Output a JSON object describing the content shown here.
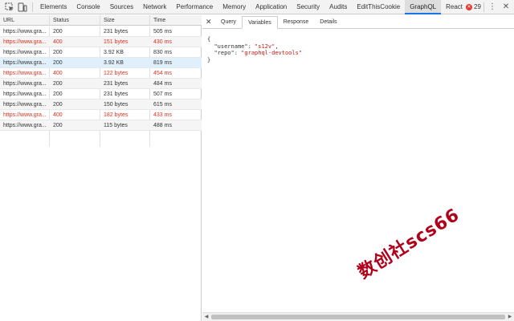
{
  "toolbar": {
    "tabs": [
      "Elements",
      "Console",
      "Sources",
      "Network",
      "Performance",
      "Memory",
      "Application",
      "Security",
      "Audits",
      "EditThisCookie",
      "GraphQL",
      "React"
    ],
    "active_tab": "GraphQL",
    "error_count": "29",
    "error_glyph": "✕",
    "menu_glyph": "⋮",
    "close_glyph": "✕"
  },
  "table": {
    "headers": [
      "URL",
      "Status",
      "Size",
      "Time"
    ],
    "rows": [
      {
        "url": "https://www.gra...",
        "status": "200",
        "size": "231 bytes",
        "time": "505 ms",
        "error": false
      },
      {
        "url": "https://www.gra...",
        "status": "400",
        "size": "151 bytes",
        "time": "430 ms",
        "error": true
      },
      {
        "url": "https://www.gra...",
        "status": "200",
        "size": "3.92 KB",
        "time": "830 ms",
        "error": false
      },
      {
        "url": "https://www.gra...",
        "status": "200",
        "size": "3.92 KB",
        "time": "819 ms",
        "error": false,
        "selected": true
      },
      {
        "url": "https://www.gra...",
        "status": "400",
        "size": "122 bytes",
        "time": "454 ms",
        "error": true
      },
      {
        "url": "https://www.gra...",
        "status": "200",
        "size": "231 bytes",
        "time": "484 ms",
        "error": false
      },
      {
        "url": "https://www.gra...",
        "status": "200",
        "size": "231 bytes",
        "time": "507 ms",
        "error": false
      },
      {
        "url": "https://www.gra...",
        "status": "200",
        "size": "150 bytes",
        "time": "615 ms",
        "error": false
      },
      {
        "url": "https://www.gra...",
        "status": "400",
        "size": "182 bytes",
        "time": "433 ms",
        "error": true
      },
      {
        "url": "https://www.gra...",
        "status": "200",
        "size": "115 bytes",
        "time": "488 ms",
        "error": false
      }
    ]
  },
  "detail": {
    "close_glyph": "✕",
    "tabs": [
      "Query",
      "Variables",
      "Response",
      "Details"
    ],
    "active_tab": "Variables",
    "code": {
      "open": "{",
      "line1_key": "\"username\"",
      "line1_val": "\"s12v\"",
      "line2_key": "\"repo\"",
      "line2_val": "\"graphql-devtools\"",
      "close": "}"
    }
  },
  "watermark": "数创社scs66",
  "colors": {
    "error_text": "#e0301e",
    "selected_row": "#e0effc",
    "active_tab_underline": "#1a73e8",
    "string_value": "#c41a16"
  }
}
